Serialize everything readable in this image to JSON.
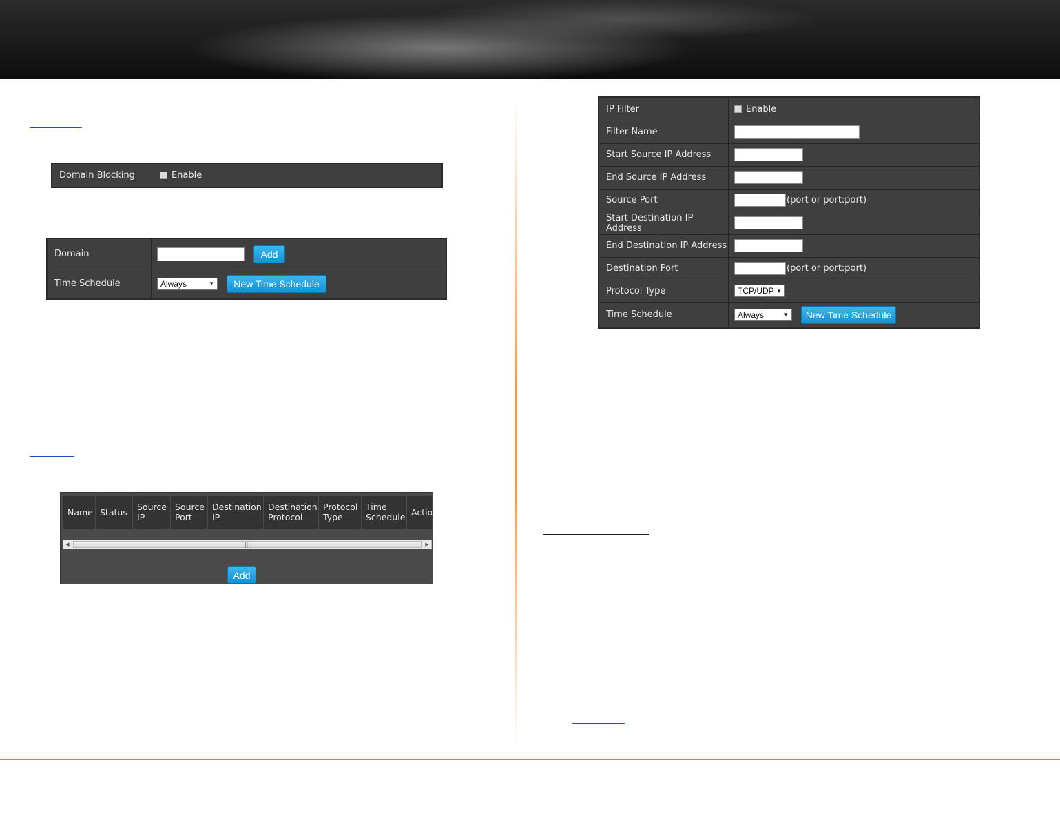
{
  "domain_blocking_panel": {
    "label": "Domain Blocking",
    "enable_label": "Enable"
  },
  "domain_panel": {
    "domain_label": "Domain",
    "add_button": "Add",
    "time_schedule_label": "Time Schedule",
    "schedule_selected": "Always",
    "new_schedule_button": "New Time Schedule"
  },
  "ip_filter_table": {
    "columns": [
      "Name",
      "Status",
      "Source IP",
      "Source Port",
      "Destination IP",
      "Destination Protocol",
      "Protocol Type",
      "Time Schedule",
      "Actio"
    ],
    "add_button": "Add"
  },
  "ip_filter_form": {
    "ip_filter_label": "IP Filter",
    "enable_label": "Enable",
    "filter_name_label": "Filter Name",
    "start_source_ip_label": "Start Source IP Address",
    "end_source_ip_label": "End Source IP Address",
    "source_port_label": "Source Port",
    "source_port_hint": "(port or port:port)",
    "start_dest_ip_label": "Start Destination IP Address",
    "end_dest_ip_label": "End Destination IP Address",
    "dest_port_label": "Destination Port",
    "dest_port_hint": "(port or port:port)",
    "protocol_type_label": "Protocol Type",
    "protocol_selected": "TCP/UDP",
    "time_schedule_label": "Time Schedule",
    "schedule_selected": "Always",
    "new_schedule_button": "New Time Schedule"
  },
  "colors": {
    "accent_orange": "#e87830",
    "button_blue": "#1591d6",
    "panel_dark": "#3f3f3f"
  }
}
